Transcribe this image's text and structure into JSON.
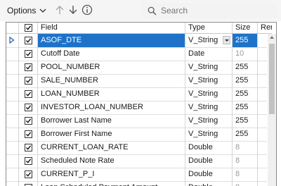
{
  "toolbar": {
    "options_label": "Options",
    "search_placeholder": "Search"
  },
  "table": {
    "headers": {
      "field": "Field",
      "type": "Type",
      "size": "Size",
      "rename": "Rename"
    },
    "rows": [
      {
        "field": "ASOF_DTE",
        "type": "V_String",
        "size": "255",
        "checked": true,
        "selected": true,
        "type_dropdown": true,
        "size_muted": false
      },
      {
        "field": "Cutoff Date",
        "type": "Date",
        "size": "10",
        "checked": true,
        "selected": false,
        "type_dropdown": false,
        "size_muted": true
      },
      {
        "field": "POOL_NUMBER",
        "type": "V_String",
        "size": "255",
        "checked": true,
        "selected": false,
        "type_dropdown": false,
        "size_muted": false
      },
      {
        "field": "SALE_NUMBER",
        "type": "V_String",
        "size": "255",
        "checked": true,
        "selected": false,
        "type_dropdown": false,
        "size_muted": false
      },
      {
        "field": "LOAN_NUMBER",
        "type": "V_String",
        "size": "255",
        "checked": true,
        "selected": false,
        "type_dropdown": false,
        "size_muted": false
      },
      {
        "field": "INVESTOR_LOAN_NUMBER",
        "type": "V_String",
        "size": "255",
        "checked": true,
        "selected": false,
        "type_dropdown": false,
        "size_muted": false
      },
      {
        "field": "Borrower Last Name",
        "type": "V_String",
        "size": "255",
        "checked": true,
        "selected": false,
        "type_dropdown": false,
        "size_muted": false
      },
      {
        "field": "Borrower First Name",
        "type": "V_String",
        "size": "255",
        "checked": true,
        "selected": false,
        "type_dropdown": false,
        "size_muted": false
      },
      {
        "field": "CURRENT_LOAN_RATE",
        "type": "Double",
        "size": "8",
        "checked": true,
        "selected": false,
        "type_dropdown": false,
        "size_muted": true
      },
      {
        "field": "Scheduled Note Rate",
        "type": "Double",
        "size": "8",
        "checked": true,
        "selected": false,
        "type_dropdown": false,
        "size_muted": true
      },
      {
        "field": "CURRENT_P_I",
        "type": "Double",
        "size": "8",
        "checked": true,
        "selected": false,
        "type_dropdown": false,
        "size_muted": true
      },
      {
        "field": "Loan Scheduled Payment Amount",
        "type": "Double",
        "size": "8",
        "checked": true,
        "selected": false,
        "type_dropdown": false,
        "size_muted": true
      }
    ]
  },
  "colors": {
    "selection": "#1e73c9",
    "accent_icon": "#666666"
  },
  "icons": [
    "chevron-down-icon",
    "arrow-up-icon",
    "arrow-down-icon",
    "info-icon",
    "search-icon",
    "row-pointer-icon",
    "checkbox-checked-icon",
    "dropdown-arrow-icon"
  ]
}
